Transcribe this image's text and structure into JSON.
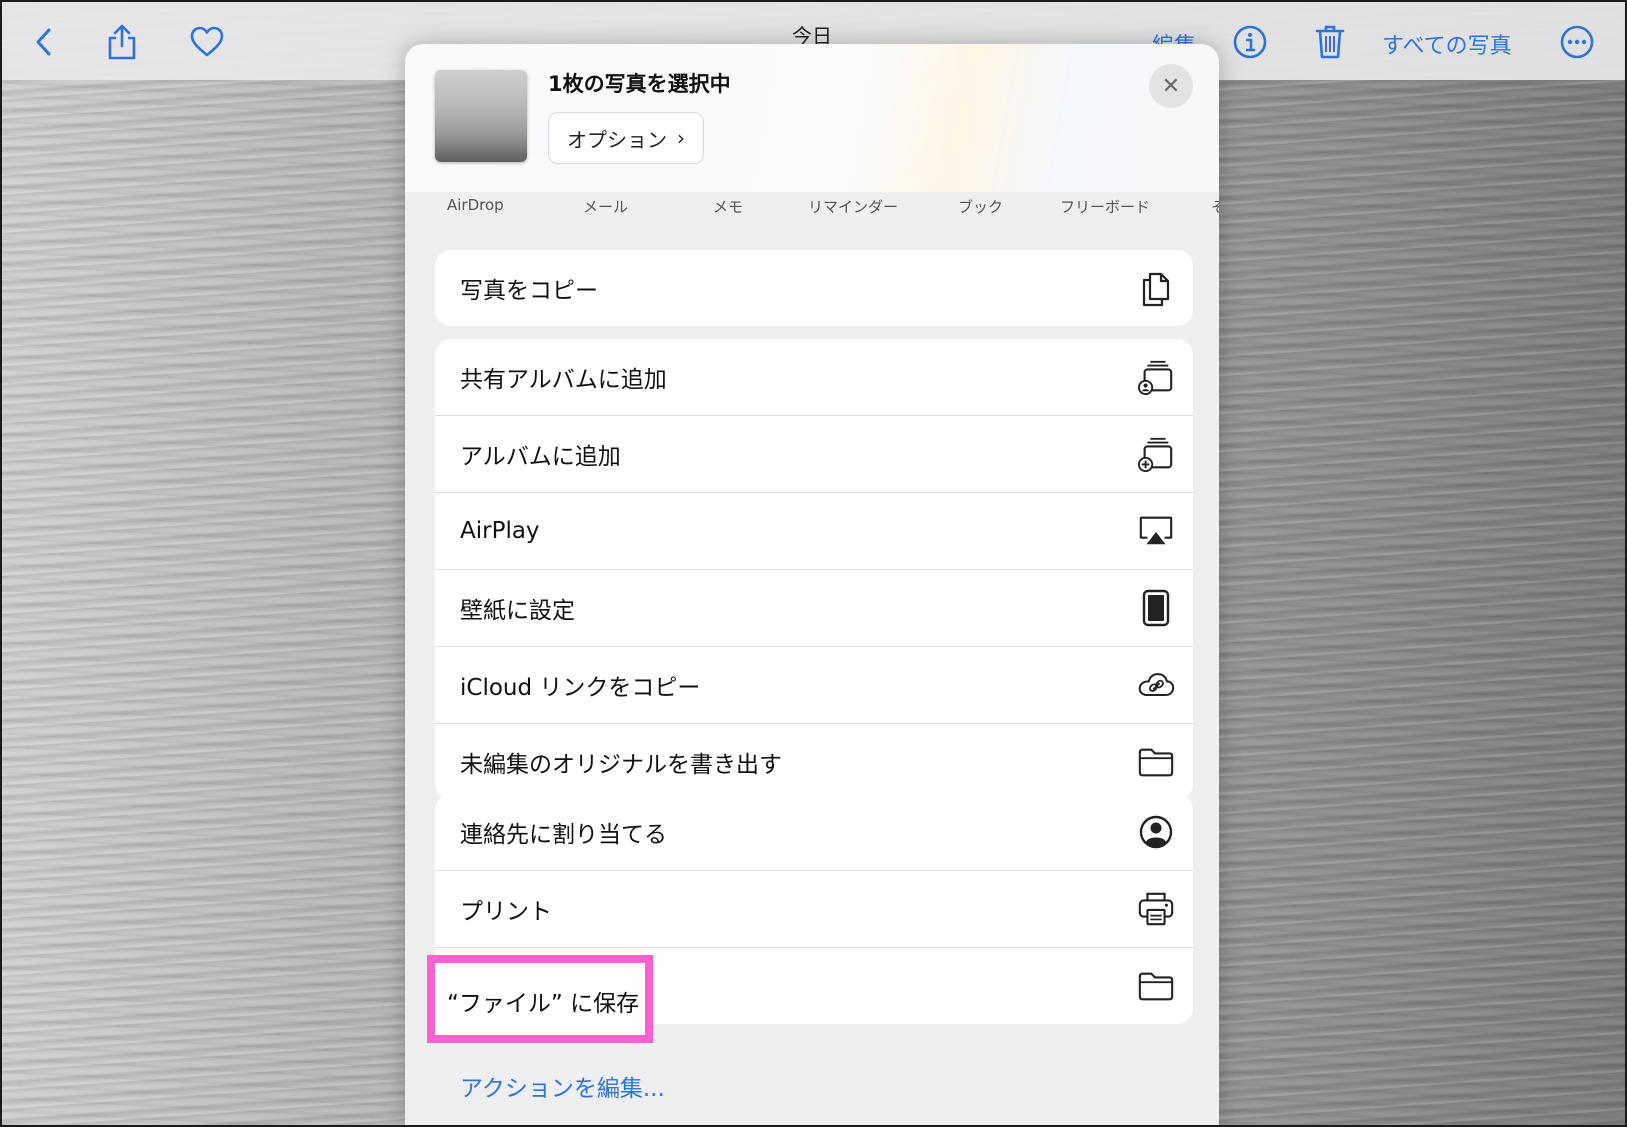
{
  "topbar": {
    "title": "今日",
    "edit_label": "編集",
    "all_photos_label": "すべての写真"
  },
  "share_sheet": {
    "selection_title": "1枚の写真を選択中",
    "options_label": "オプション",
    "options_chevron": "›",
    "close_symbol": "✕",
    "apps": [
      "AirDrop",
      "メール",
      "メモ",
      "リマインダー",
      "ブック",
      "フリーボード",
      "そ"
    ],
    "groups": [
      {
        "rows": [
          {
            "label": "写真をコピー",
            "icon": "copy-icon"
          }
        ]
      },
      {
        "rows": [
          {
            "label": "共有アルバムに追加",
            "icon": "shared-album-icon"
          },
          {
            "label": "アルバムに追加",
            "icon": "add-album-icon"
          },
          {
            "label": "AirPlay",
            "icon": "airplay-icon"
          },
          {
            "label": "壁紙に設定",
            "icon": "ipad-icon"
          },
          {
            "label": "iCloud リンクをコピー",
            "icon": "cloud-link-icon"
          },
          {
            "label": "未編集のオリジナルを書き出す",
            "icon": "folder-icon"
          }
        ]
      },
      {
        "rows": [
          {
            "label": "連絡先に割り当てる",
            "icon": "contact-icon"
          },
          {
            "label": "プリント",
            "icon": "printer-icon"
          },
          {
            "label": "“ファイル” に保存",
            "icon": "folder-icon"
          }
        ]
      }
    ],
    "edit_actions_label": "アクションを編集..."
  },
  "colors": {
    "accent": "#2f73d8",
    "highlight": "#ff5fcf"
  }
}
